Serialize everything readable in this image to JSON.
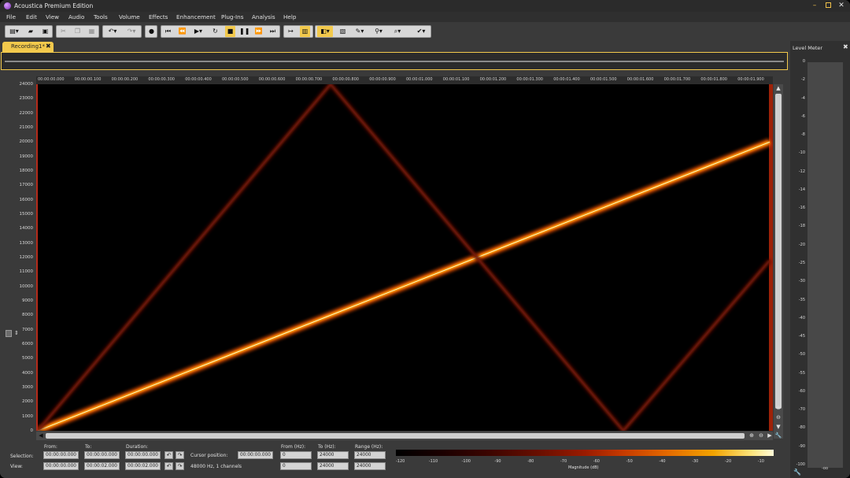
{
  "window": {
    "title": "Acoustica Premium Edition",
    "controls": {
      "min": "–",
      "close": "✕"
    }
  },
  "menu": [
    "File",
    "Edit",
    "View",
    "Audio",
    "Tools",
    "Volume",
    "Effects",
    "Enhancement",
    "Plug-Ins",
    "Analysis",
    "Help"
  ],
  "toolbar": {
    "icons": [
      "new-icon",
      "open-icon",
      "save-icon",
      "cut-icon",
      "copy-icon",
      "paste-icon",
      "undo-icon",
      "redo-icon",
      "record-icon",
      "go-start-icon",
      "rewind-icon",
      "play-icon",
      "loop-icon",
      "stop-icon",
      "pause-icon",
      "fast-forward-icon",
      "go-end-icon",
      "fit-icon",
      "spectrogram-view-icon",
      "selection-tool-icon",
      "spectral-view-icon",
      "brush-tool-icon",
      "wand-tool-icon",
      "zoom-tool-icon",
      "heal-tool-icon"
    ]
  },
  "tab": {
    "label": "Recording1*",
    "close": "✖"
  },
  "ruler": {
    "ticks": [
      "00:00:00.000",
      "00:00:00.100",
      "00:00:00.200",
      "00:00:00.300",
      "00:00:00.400",
      "00:00:00.500",
      "00:00:00.600",
      "00:00:00.700",
      "00:00:00.800",
      "00:00:00.900",
      "00:00:01.000",
      "00:00:01.100",
      "00:00:01.200",
      "00:00:01.300",
      "00:00:01.400",
      "00:00:01.500",
      "00:00:01.600",
      "00:00:01.700",
      "00:00:01.800",
      "00:00:01.900"
    ]
  },
  "freq_axis": {
    "labels": [
      "24000",
      "23000",
      "22000",
      "21000",
      "20000",
      "19000",
      "18000",
      "17000",
      "16000",
      "15000",
      "14000",
      "13000",
      "12000",
      "11000",
      "10000",
      "9000",
      "8000",
      "7000",
      "6000",
      "5000",
      "4000",
      "3000",
      "2000",
      "1000",
      "0"
    ]
  },
  "spectrogram": {
    "duration_s": 2.0,
    "max_hz": 24000,
    "sweeps": [
      {
        "name": "linear",
        "points": [
          [
            0,
            0
          ],
          [
            2.0,
            20000
          ]
        ],
        "color": "#ffb000",
        "glow": "#ff5a00"
      },
      {
        "name": "triangle",
        "points": [
          [
            0,
            0
          ],
          [
            0.8,
            24000
          ],
          [
            1.6,
            0
          ],
          [
            2.0,
            11800
          ]
        ],
        "color": "#7a1a08",
        "glow": "#5a1005"
      }
    ]
  },
  "bottom": {
    "selection_label": "Selection:",
    "view_label": "View:",
    "from_label": "From:",
    "to_label": "To:",
    "duration_label": "Duration:",
    "cursor_label": "Cursor position:",
    "cursor_value": "00:00:00.000",
    "format": "48000 Hz, 1 channels",
    "selection_from": "00:00:00.000",
    "selection_to": "00:00:00.000",
    "selection_duration": "00:00:00.000",
    "view_from": "00:00:00.000",
    "view_to": "00:00:02.000",
    "view_duration": "00:00:02.000",
    "from_hz_label": "From (Hz):",
    "to_hz_label": "To (Hz):",
    "range_hz_label": "Range (Hz):",
    "sel_from_hz": "0",
    "sel_to_hz": "24000",
    "sel_range_hz": "24000",
    "view_from_hz": "0",
    "view_to_hz": "24000",
    "view_range_hz": "24000",
    "magnitude_label": "Magnitude (dB)",
    "magnitude_ticks": [
      "-120",
      "-110",
      "-100",
      "-90",
      "-80",
      "-70",
      "-60",
      "-50",
      "-40",
      "-30",
      "-20",
      "-10"
    ]
  },
  "level_meter": {
    "title": "Level Meter",
    "close": "✖",
    "labels": [
      "0",
      "-2",
      "-4",
      "-6",
      "-8",
      "-10",
      "-12",
      "-14",
      "-16",
      "-18",
      "-20",
      "-25",
      "-30",
      "-35",
      "-40",
      "-45",
      "-50",
      "-55",
      "-60",
      "-70",
      "-80",
      "-90",
      "-100"
    ],
    "floor": "-oo"
  }
}
